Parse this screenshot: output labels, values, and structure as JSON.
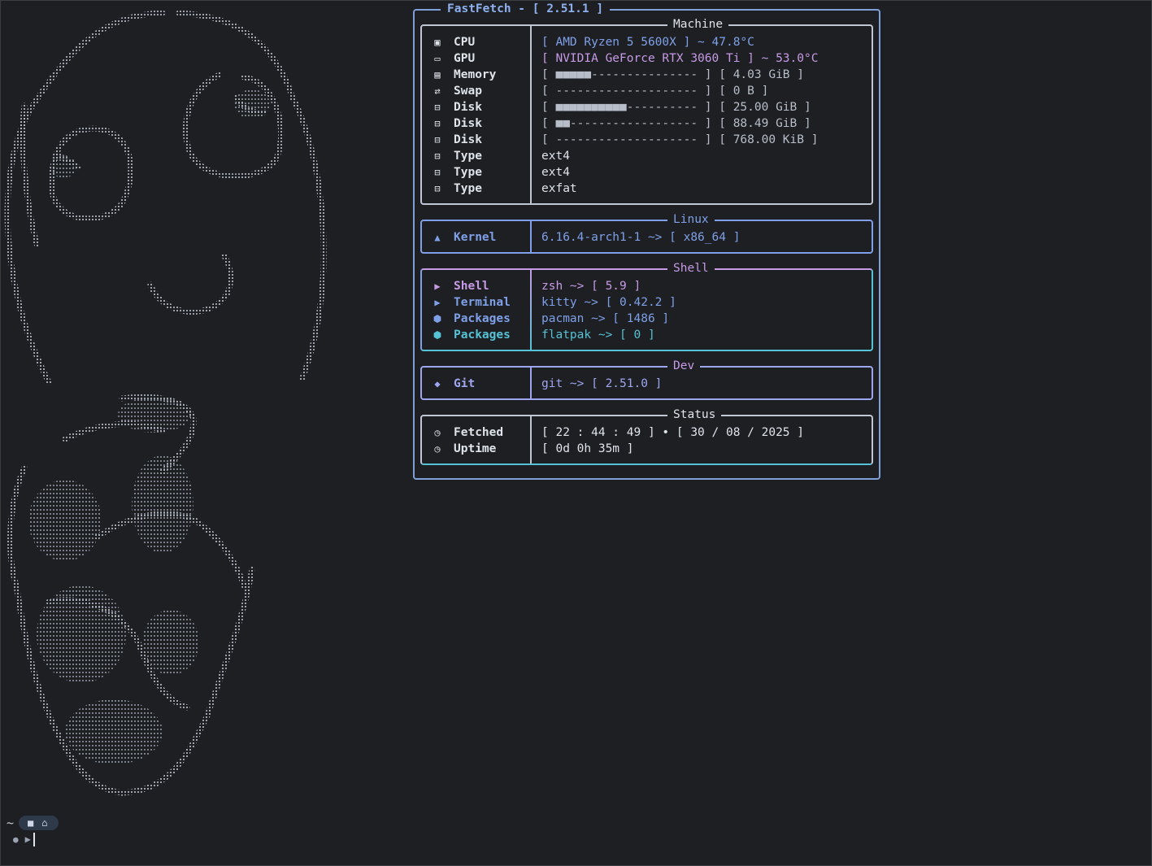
{
  "title": {
    "app": "FastFetch",
    "version": "2.51.1"
  },
  "colors": {
    "blue": "#7fa0e8",
    "mauve": "#c79ae6",
    "teal": "#56c2d6",
    "dim": "#5c6370",
    "background": "#1d1f22"
  },
  "machine": {
    "title": "Machine",
    "rows": [
      {
        "icon": "cpu-icon",
        "label": "CPU",
        "value": "[ AMD Ryzen 5 5600X ] ~ 47.8°C"
      },
      {
        "icon": "gpu-icon",
        "label": "GPU",
        "value": "[ NVIDIA GeForce RTX 3060 Ti ] ~ 53.0°C"
      },
      {
        "icon": "memory-icon",
        "label": "Memory",
        "value": "[ ■■■■■--------------- ] [ 4.03 GiB ]"
      },
      {
        "icon": "swap-icon",
        "label": "Swap",
        "value": "[ -------------------- ] [ 0 B ]"
      },
      {
        "icon": "disk-icon",
        "label": "Disk",
        "value": "[ ■■■■■■■■■■---------- ] [ 25.00 GiB ]"
      },
      {
        "icon": "disk-icon",
        "label": "Disk",
        "value": "[ ■■------------------ ] [ 88.49 GiB ]"
      },
      {
        "icon": "disk-icon",
        "label": "Disk",
        "value": "[ -------------------- ] [ 768.00 KiB ]"
      },
      {
        "icon": "disk-icon",
        "label": "Type",
        "value": "ext4"
      },
      {
        "icon": "disk-icon",
        "label": "Type",
        "value": "ext4"
      },
      {
        "icon": "disk-icon",
        "label": "Type",
        "value": "exfat"
      }
    ]
  },
  "linux": {
    "title": "Linux",
    "rows": [
      {
        "icon": "arch-icon",
        "label": "Kernel",
        "value": "6.16.4-arch1-1 ~> [ x86_64 ]"
      }
    ]
  },
  "shell": {
    "title": "Shell",
    "rows": [
      {
        "icon": "terminal-icon",
        "label": "Shell",
        "value": "zsh ~> [ 5.9 ]"
      },
      {
        "icon": "terminal-icon",
        "label": "Terminal",
        "value": "kitty ~> [ 0.42.2 ]"
      },
      {
        "icon": "package-icon",
        "label": "Packages",
        "value": "pacman ~> [ 1486 ]"
      },
      {
        "icon": "package-icon",
        "label": "Packages",
        "value": "flatpak ~> [ 0 ]"
      }
    ]
  },
  "dev": {
    "title": "Dev",
    "rows": [
      {
        "icon": "git-icon",
        "label": "Git",
        "value": "git ~> [ 2.51.0 ]"
      }
    ]
  },
  "status": {
    "title": "Status",
    "rows": [
      {
        "icon": "clock-icon",
        "label": "Fetched",
        "value": "[ 22 : 44 : 49 ] • [ 30 / 08 / 2025 ]"
      },
      {
        "icon": "clock-icon",
        "label": "Uptime",
        "value": "[ 0d 0h 35m ]"
      }
    ]
  },
  "prompt": {
    "path": "~"
  }
}
